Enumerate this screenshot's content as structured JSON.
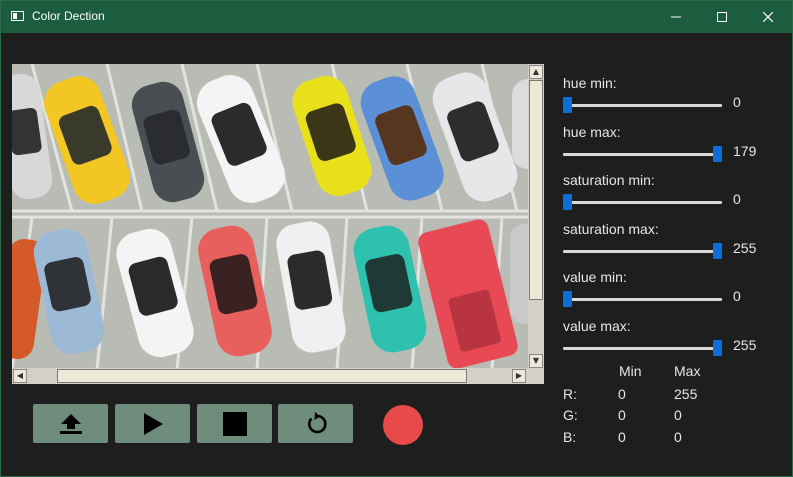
{
  "window": {
    "title": "Color Dection"
  },
  "colors": {
    "titlebar": "#1b5d3e",
    "button": "#6e8d7c",
    "record": "#e84a4a",
    "handle": "#0a6fd8"
  },
  "controls": {
    "upload_icon": "upload-icon",
    "play_icon": "play-icon",
    "stop_icon": "stop-icon",
    "reset_icon": "reset-icon"
  },
  "sliders": [
    {
      "label": "hue min:",
      "value": "0",
      "fraction": 0.0
    },
    {
      "label": "hue max:",
      "value": "179",
      "fraction": 1.0
    },
    {
      "label": "saturation min:",
      "value": "0",
      "fraction": 0.0
    },
    {
      "label": "saturation max:",
      "value": "255",
      "fraction": 1.0
    },
    {
      "label": "value min:",
      "value": "0",
      "fraction": 0.0
    },
    {
      "label": "value max:",
      "value": "255",
      "fraction": 1.0
    }
  ],
  "rgb_table": {
    "header_min": "Min",
    "header_max": "Max",
    "rows": [
      {
        "channel": "R:",
        "min": "0",
        "max": "255"
      },
      {
        "channel": "G:",
        "min": "0",
        "max": "0"
      },
      {
        "channel": "B:",
        "min": "0",
        "max": "0"
      }
    ]
  }
}
